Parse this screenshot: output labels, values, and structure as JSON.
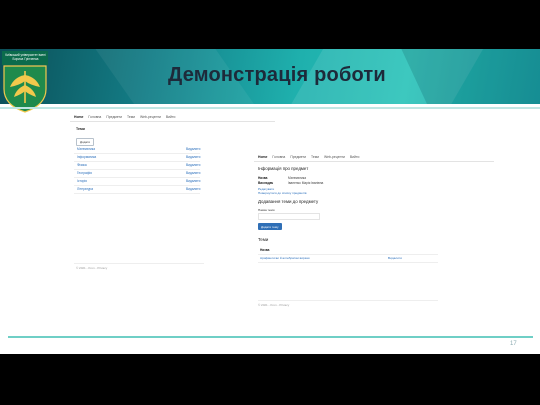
{
  "slide": {
    "title": "Демонстрація роботи",
    "page_number": "17",
    "logo_text": "Київський університет імені Бориса Грінченка"
  },
  "colors": {
    "banner_dark": "#0b4f58",
    "banner_light": "#27c2b8",
    "link": "#2a6ebb",
    "primary_button": "#2f6fb6"
  },
  "screenshot1": {
    "nav": {
      "brand": "Home",
      "items": [
        "Головна",
        "Предмети",
        "Теми",
        "Web-рецепти",
        "Вийти"
      ]
    },
    "heading": "Теми",
    "button": "Додати",
    "rows": [
      {
        "name": "Математика",
        "action": "Видалити"
      },
      {
        "name": "Інформатика",
        "action": "Видалити"
      },
      {
        "name": "Фізика",
        "action": "Видалити"
      },
      {
        "name": "Географія",
        "action": "Видалити"
      },
      {
        "name": "Історія",
        "action": "Видалити"
      },
      {
        "name": "Література",
        "action": "Видалити"
      }
    ],
    "footer": "© 2021 - Kron - Privacy"
  },
  "screenshot2": {
    "nav": {
      "brand": "Home",
      "items": [
        "Головна",
        "Предмети",
        "Теми",
        "Web-рецепти",
        "Вийти"
      ]
    },
    "heading": "Інформація про предмет",
    "fields": [
      {
        "key": "Назва",
        "value": "Математика"
      },
      {
        "key": "Викладач",
        "value": "Іваненко Марія Іванівна"
      }
    ],
    "edit_link": "Редагувати",
    "back_link": "Повернутися до списку предметів",
    "add_heading": "Додавання теми до предмету",
    "topic_label": "Назва теми",
    "add_button": "Додати тему",
    "topics_heading": "Теми",
    "table_header": "Назва",
    "topics": [
      {
        "name": "Арифметичні й алгебраїчні вирази",
        "action": "Видалити"
      }
    ],
    "footer": "© 2021 - Kron - Privacy"
  }
}
